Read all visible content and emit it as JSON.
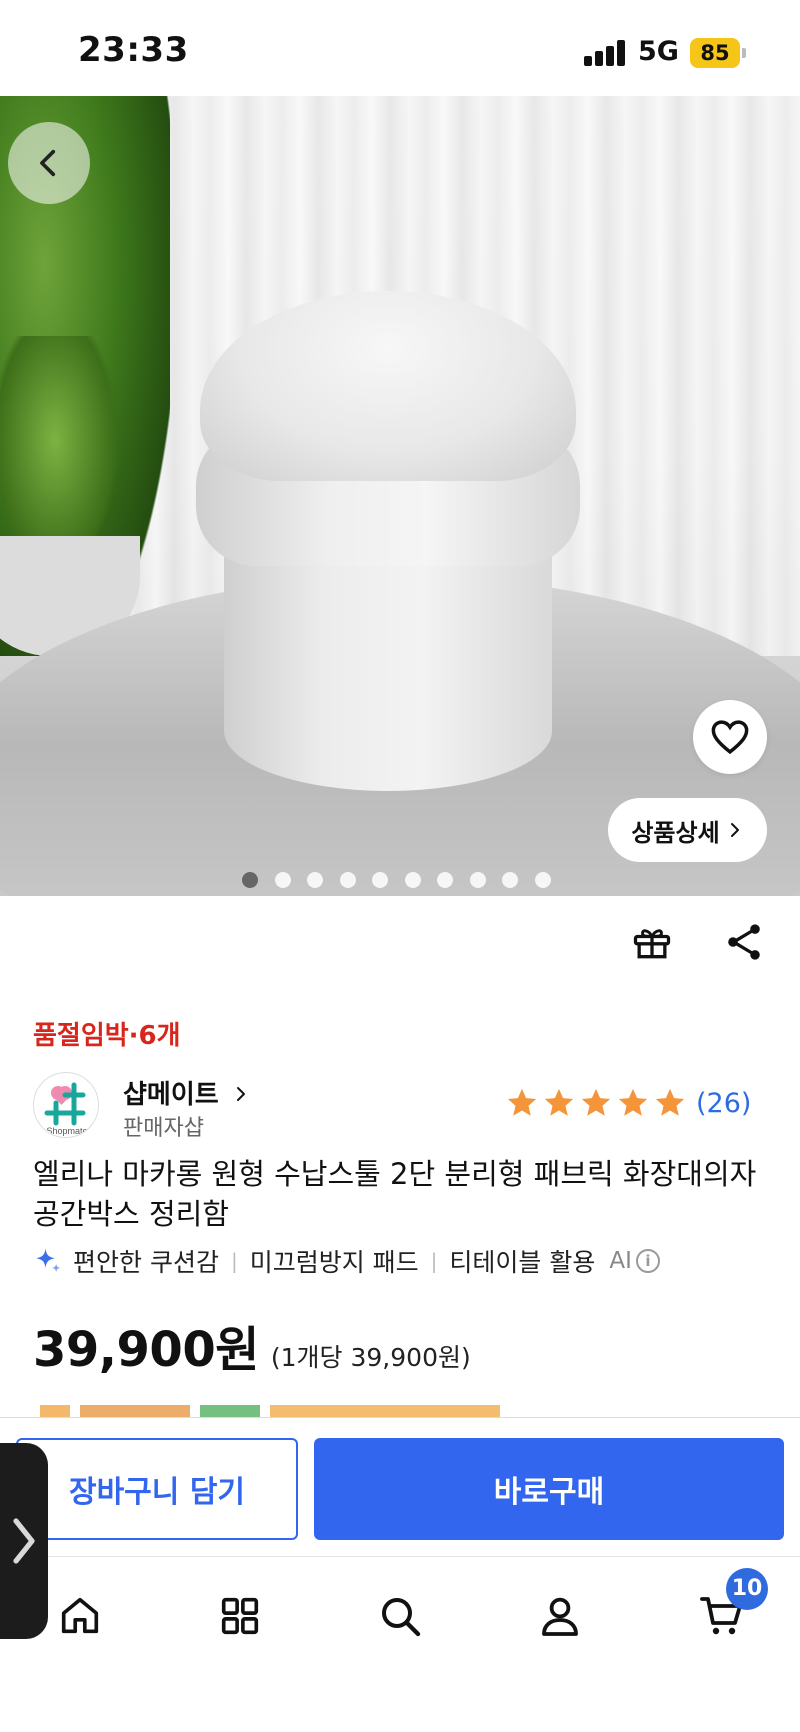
{
  "status_bar": {
    "time": "23:33",
    "network": "5G",
    "battery": "85"
  },
  "hero": {
    "detail_button_label": "상품상세",
    "image_count": 10,
    "active_index": 0
  },
  "product": {
    "stock_warning": "품절임박·6개",
    "seller": {
      "name": "샵메이트",
      "subtitle": "판매자샵",
      "logo_text": "Shopmate"
    },
    "rating": {
      "stars": 5,
      "review_count": "(26)",
      "star_color": "#f5953a"
    },
    "title": "엘리나 마카롱 원형 수납스툴 2단 분리형 패브릭 화장대의자 공간박스 정리함",
    "ai_tags": [
      "편안한 쿠션감",
      "미끄럼방지 패드",
      "티테이블 활용"
    ],
    "ai_label": "AI",
    "price": "39,900원",
    "unit_price": "(1개당 39,900원)"
  },
  "actions": {
    "add_to_cart": "장바구니 담기",
    "buy_now": "바로구매"
  },
  "nav": {
    "cart_count": "10"
  },
  "colors": {
    "accent": "#3366ee",
    "warning": "#d9261c",
    "link": "#2f6bdf"
  }
}
